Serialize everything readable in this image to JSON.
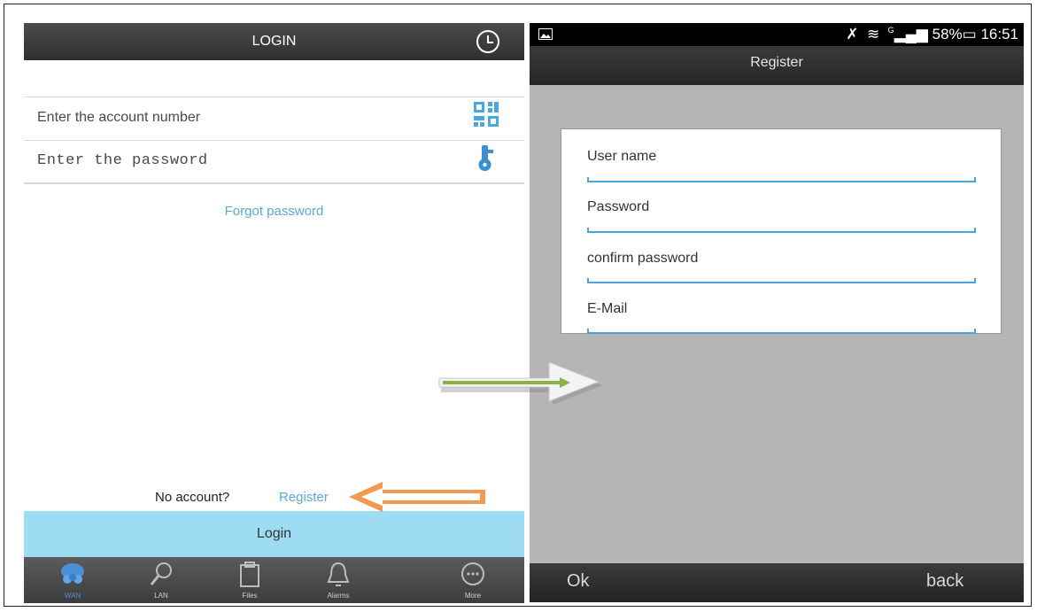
{
  "login": {
    "title": "LOGIN",
    "account_placeholder": "Enter the account number",
    "password_placeholder": "Enter the password",
    "forgot_password": "Forgot password",
    "no_account": "No account?",
    "register_link": "Register",
    "login_button": "Login",
    "tabs": [
      {
        "label": "WAN",
        "icon": "cloud-users-icon"
      },
      {
        "label": "LAN",
        "icon": "search-icon"
      },
      {
        "label": "Files",
        "icon": "clipboard-icon"
      },
      {
        "label": "Alarms",
        "icon": "bell-icon"
      },
      {
        "label": "More",
        "icon": "more-icon"
      }
    ]
  },
  "register": {
    "status": {
      "battery": "58%",
      "time": "16:51",
      "signal_label": "G"
    },
    "title": "Register",
    "fields": [
      {
        "label": "User name"
      },
      {
        "label": "Password"
      },
      {
        "label": "confirm password"
      },
      {
        "label": "E-Mail"
      }
    ],
    "ok_button": "Ok",
    "back_button": "back"
  },
  "colors": {
    "accent_blue": "#5aa9d9",
    "login_button": "#9edcf4",
    "arrow_green": "#8db24a",
    "arrow_orange": "#f29a52"
  }
}
